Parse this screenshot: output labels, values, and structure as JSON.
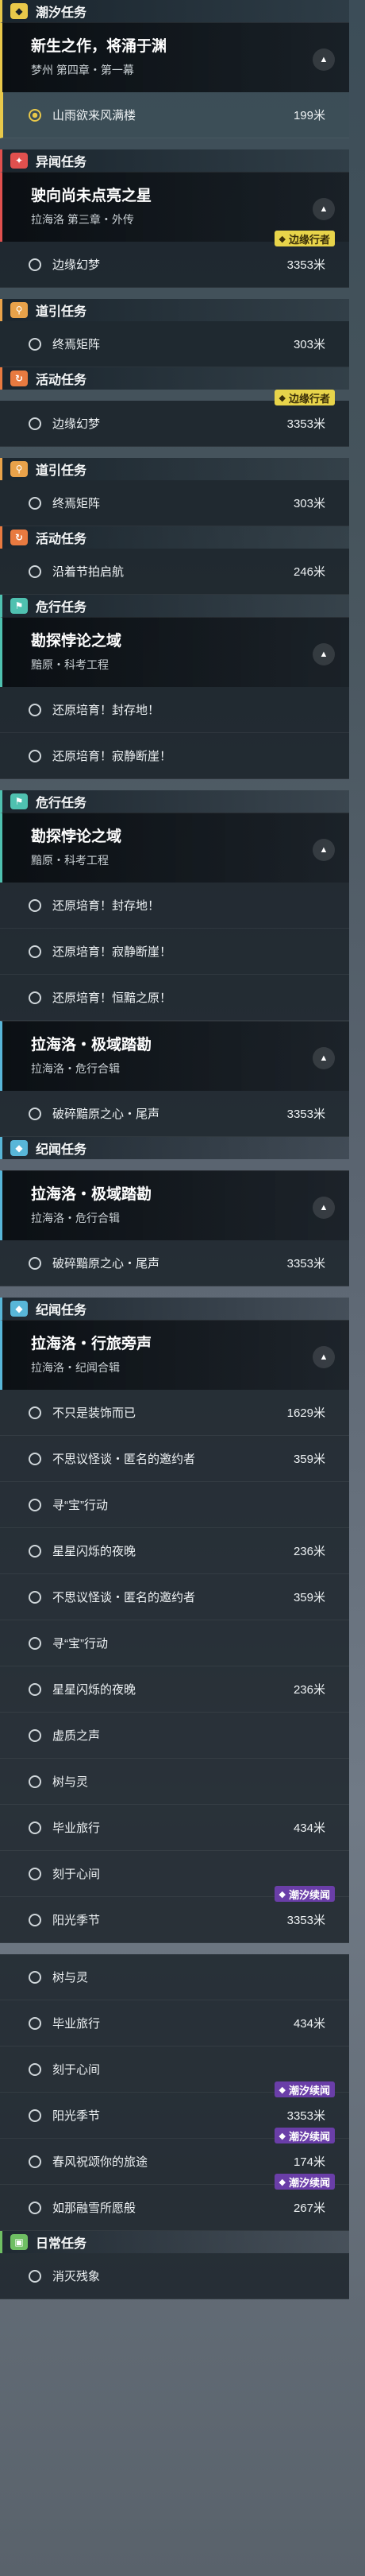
{
  "icons": {
    "tidal": "◆",
    "odd": "✦",
    "guide": "⚲",
    "event": "↻",
    "danger": "⚑",
    "chron": "◆",
    "daily": "▣",
    "collapse": "▲",
    "ring": "○"
  },
  "colors": {
    "tidal": "#e8c84a",
    "odd": "#e0504e",
    "guide": "#e8a24a",
    "event": "#e87a40",
    "danger": "#4fc1b0",
    "chron": "#58b6d8",
    "daily": "#6fbf63"
  },
  "items": [
    {
      "k": "cat",
      "style": "tidal",
      "label": "潮汐任务"
    },
    {
      "k": "card",
      "style": "tidalc",
      "title": "新生之作，将涌于渊",
      "sub": "梦州 第四章・第一幕"
    },
    {
      "k": "row",
      "label": "山雨欲来风满楼",
      "dist": "199米",
      "active": true
    },
    {
      "k": "gap"
    },
    {
      "k": "cat",
      "style": "odd",
      "label": "异闻任务"
    },
    {
      "k": "card",
      "style": "oddc",
      "title": "驶向尚未点亮之星",
      "sub": "拉海洛 第三章・外传"
    },
    {
      "k": "row",
      "label": "边缘幻梦",
      "dist": "3353米",
      "badge": "边缘行者",
      "badgeStyle": "yellow"
    },
    {
      "k": "gap"
    },
    {
      "k": "cat",
      "style": "guide",
      "label": "道引任务"
    },
    {
      "k": "row",
      "label": "终焉矩阵",
      "dist": "303米"
    },
    {
      "k": "cat",
      "style": "event",
      "label": "活动任务"
    },
    {
      "k": "gap"
    },
    {
      "k": "row",
      "label": "边缘幻梦",
      "dist": "3353米",
      "badge": "边缘行者",
      "badgeStyle": "yellow"
    },
    {
      "k": "gap"
    },
    {
      "k": "cat",
      "style": "guide",
      "label": "道引任务"
    },
    {
      "k": "row",
      "label": "终焉矩阵",
      "dist": "303米"
    },
    {
      "k": "cat",
      "style": "event",
      "label": "活动任务"
    },
    {
      "k": "row",
      "label": "沿着节拍启航",
      "dist": "246米"
    },
    {
      "k": "cat",
      "style": "danger",
      "label": "危行任务"
    },
    {
      "k": "card",
      "style": "dangerc",
      "title": "勘探悖论之域",
      "sub": "黯原・科考工程"
    },
    {
      "k": "row",
      "label": "还原培育！封存地！",
      "dist": ""
    },
    {
      "k": "row",
      "label": "还原培育！寂静断崖！",
      "dist": ""
    },
    {
      "k": "gap"
    },
    {
      "k": "cat",
      "style": "danger",
      "label": "危行任务"
    },
    {
      "k": "card",
      "style": "dangerc",
      "title": "勘探悖论之域",
      "sub": "黯原・科考工程"
    },
    {
      "k": "row",
      "label": "还原培育！封存地！",
      "dist": ""
    },
    {
      "k": "row",
      "label": "还原培育！寂静断崖！",
      "dist": ""
    },
    {
      "k": "row",
      "label": "还原培育！恒黯之原！",
      "dist": ""
    },
    {
      "k": "card",
      "style": "chronc",
      "title": "拉海洛・极域踏勘",
      "sub": "拉海洛・危行合辑"
    },
    {
      "k": "row",
      "label": "破碎黯原之心・尾声",
      "dist": "3353米"
    },
    {
      "k": "cat",
      "style": "chron",
      "label": "纪闻任务"
    },
    {
      "k": "gap"
    },
    {
      "k": "card",
      "style": "chronc",
      "title": "拉海洛・极域踏勘",
      "sub": "拉海洛・危行合辑"
    },
    {
      "k": "row",
      "label": "破碎黯原之心・尾声",
      "dist": "3353米"
    },
    {
      "k": "gap"
    },
    {
      "k": "cat",
      "style": "chron",
      "label": "纪闻任务"
    },
    {
      "k": "card",
      "style": "chronc",
      "title": "拉海洛・行旅旁声",
      "sub": "拉海洛・纪闻合辑"
    },
    {
      "k": "row",
      "label": "不只是装饰而已",
      "dist": "1629米"
    },
    {
      "k": "row",
      "label": "不思议怪谈・匿名的邀约者",
      "dist": "359米"
    },
    {
      "k": "row",
      "label": "寻“宝”行动",
      "dist": ""
    },
    {
      "k": "row",
      "label": "星星闪烁的夜晚",
      "dist": "236米"
    },
    {
      "k": "row",
      "label": "不思议怪谈・匿名的邀约者",
      "dist": "359米"
    },
    {
      "k": "row",
      "label": "寻“宝”行动",
      "dist": ""
    },
    {
      "k": "row",
      "label": "星星闪烁的夜晚",
      "dist": "236米"
    },
    {
      "k": "row",
      "label": "虚质之声",
      "dist": ""
    },
    {
      "k": "row",
      "label": "树与灵",
      "dist": ""
    },
    {
      "k": "row",
      "label": "毕业旅行",
      "dist": "434米"
    },
    {
      "k": "row",
      "label": "刻于心间",
      "dist": ""
    },
    {
      "k": "row",
      "label": "阳光季节",
      "dist": "3353米",
      "badge": "潮汐续闻",
      "badgeStyle": "purple"
    },
    {
      "k": "gap"
    },
    {
      "k": "row",
      "label": "树与灵",
      "dist": ""
    },
    {
      "k": "row",
      "label": "毕业旅行",
      "dist": "434米"
    },
    {
      "k": "row",
      "label": "刻于心间",
      "dist": ""
    },
    {
      "k": "row",
      "label": "阳光季节",
      "dist": "3353米",
      "badge": "潮汐续闻",
      "badgeStyle": "purple"
    },
    {
      "k": "row",
      "label": "春风祝颂你的旅途",
      "dist": "174米",
      "badge": "潮汐续闻",
      "badgeStyle": "purple"
    },
    {
      "k": "row",
      "label": "如那融雪所愿般",
      "dist": "267米",
      "badge": "潮汐续闻",
      "badgeStyle": "purple"
    },
    {
      "k": "cat",
      "style": "daily",
      "label": "日常任务"
    },
    {
      "k": "row",
      "label": "消灭残象",
      "dist": ""
    }
  ]
}
